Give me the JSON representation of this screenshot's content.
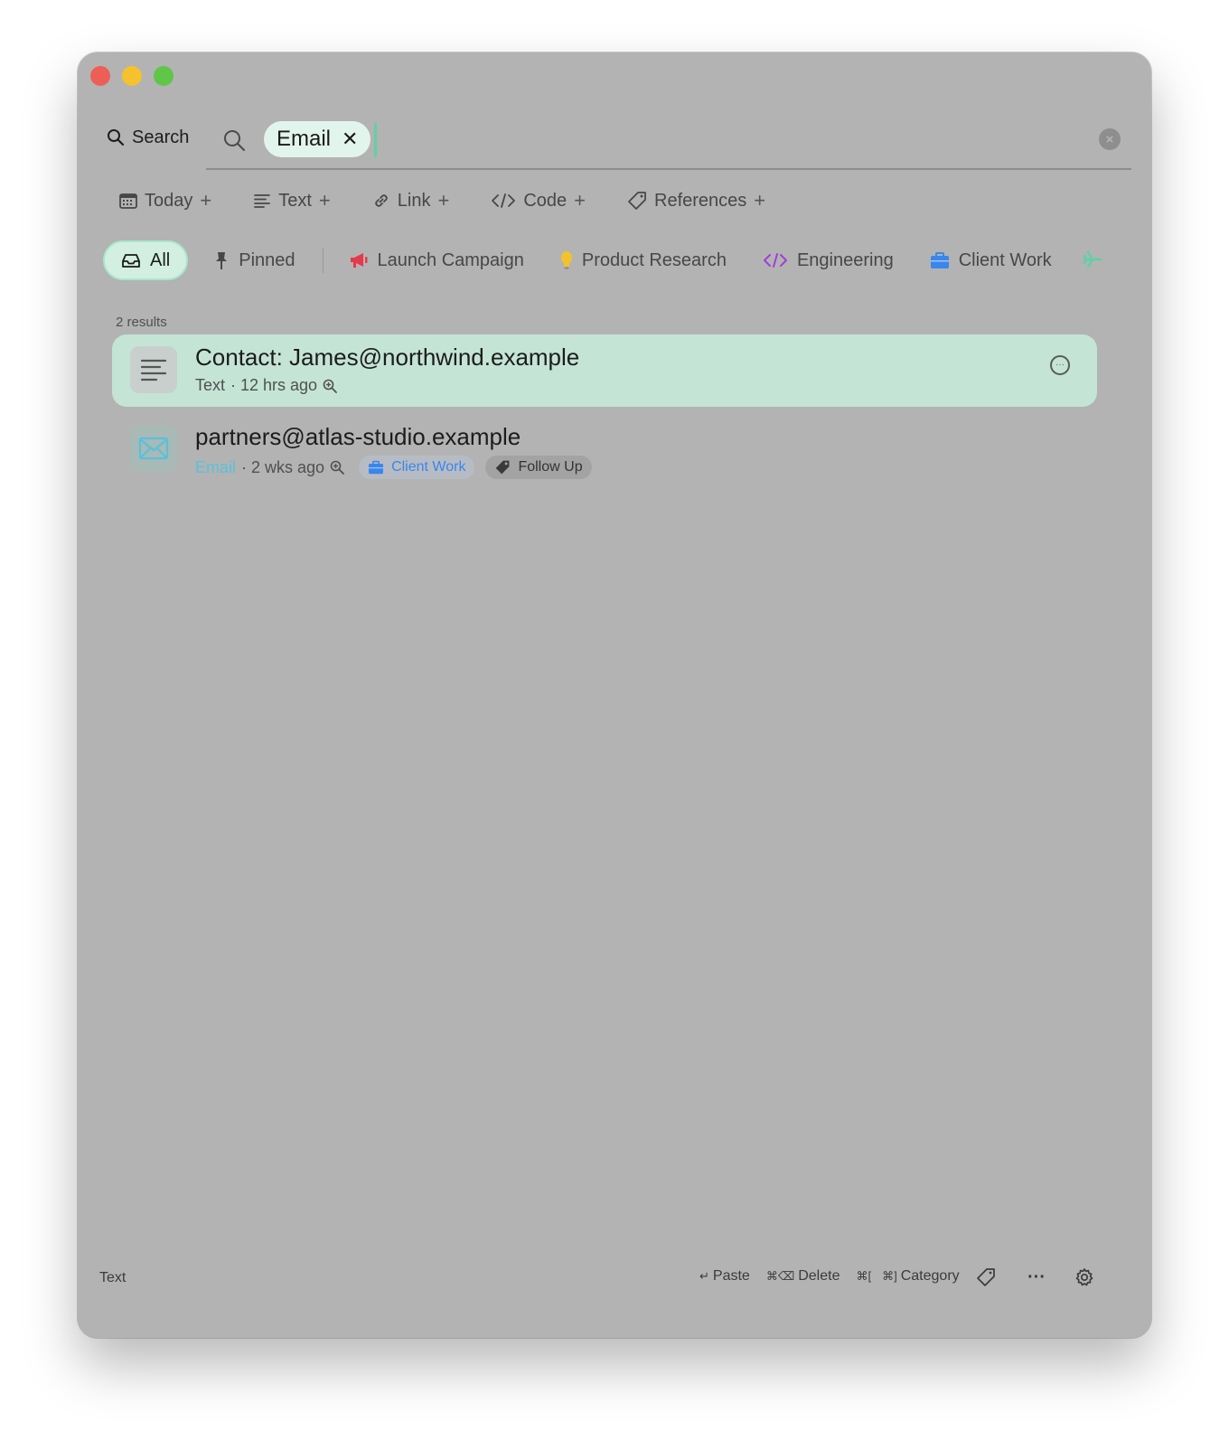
{
  "search": {
    "label": "Search",
    "chip_label": "Email",
    "chip_remove": "✕"
  },
  "filters": [
    {
      "label": "Today",
      "icon": "calendar-icon"
    },
    {
      "label": "Text",
      "icon": "text-lines-icon"
    },
    {
      "label": "Link",
      "icon": "link-icon"
    },
    {
      "label": "Code",
      "icon": "code-icon"
    },
    {
      "label": "References",
      "icon": "tag-icon"
    }
  ],
  "filter_add": "+",
  "categories": {
    "all": "All",
    "pinned": "Pinned",
    "launch": "Launch Campaign",
    "research": "Product Research",
    "engineering": "Engineering",
    "client": "Client Work"
  },
  "results": {
    "count": "2 results",
    "items": [
      {
        "title": "Contact: James@northwind.example",
        "type": "Text",
        "time": "· 12 hrs ago"
      },
      {
        "title": "partners@atlas-studio.example",
        "type": "Email",
        "time": "· 2 wks ago",
        "category": "Client Work",
        "tag": "Follow Up"
      }
    ]
  },
  "footer": {
    "left": "Text",
    "paste_key": "↵",
    "paste": "Paste",
    "delete_key": "⌘⌫",
    "delete": "Delete",
    "category_key_prev": "⌘[",
    "category_key_next": "⌘]",
    "category": "Category",
    "more": "···"
  },
  "colors": {
    "accent": "#5fd1a6",
    "window_bg": "#b3b3b3",
    "selected_row": "#c4e4d6",
    "launch_red": "#e5394d",
    "research_yellow": "#f3c22c",
    "engineering_purple": "#a03ed8",
    "client_blue": "#3a86ea",
    "email_cyan": "#56c2dc"
  }
}
